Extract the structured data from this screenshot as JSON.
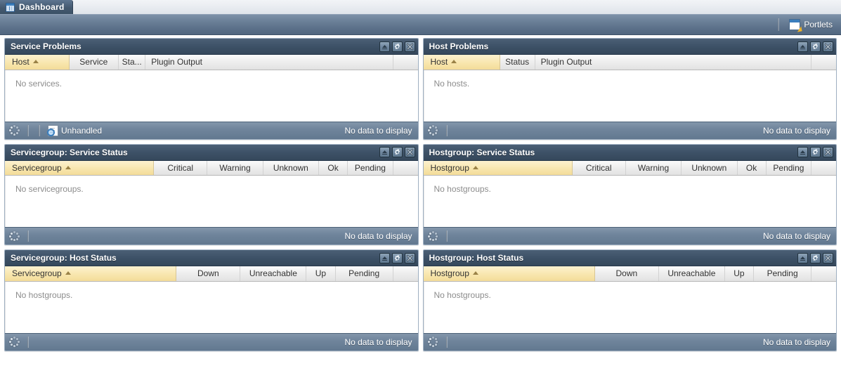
{
  "tabbar": {
    "tabs": [
      {
        "label": "Dashboard",
        "icon": "dashboard-icon",
        "active": true
      }
    ]
  },
  "toolbar": {
    "portlets_label": "Portlets",
    "portlets_icon": "portlets-icon"
  },
  "panel_tools": {
    "collapse_title": "Collapse",
    "settings_title": "Settings",
    "close_title": "Close"
  },
  "footer_common": {
    "refresh_icon": "refresh-spinner-icon",
    "no_data": "No data to display"
  },
  "colors": {
    "header_dark": "#3d5167",
    "toolbar_blue": "#62788f",
    "sort_highlight": "#f8e6ae",
    "tab_active": "#44596f",
    "empty_text": "#8c8c8c"
  },
  "panels": [
    {
      "id": "service-problems",
      "title": "Service Problems",
      "columns": [
        {
          "label": "Host",
          "sorted": true,
          "sort_dir": "asc",
          "width": "15.5%"
        },
        {
          "label": "Service",
          "sorted": false,
          "width": "12%"
        },
        {
          "label": "Sta...",
          "sorted": false,
          "width": "6.5%"
        },
        {
          "label": "Plugin Output",
          "sorted": false,
          "width": "60%",
          "align": "left"
        },
        {
          "label": "",
          "sorted": false,
          "width": "6%",
          "pad": true
        }
      ],
      "empty_message": "No services.",
      "footer": {
        "filter_label": "Unhandled",
        "filter_icon": "filter-page-icon",
        "status": "No data to display",
        "has_filter": true
      }
    },
    {
      "id": "host-problems",
      "title": "Host Problems",
      "columns": [
        {
          "label": "Host",
          "sorted": true,
          "sort_dir": "asc",
          "width": "18.5%"
        },
        {
          "label": "Status",
          "sorted": false,
          "width": "8.5%"
        },
        {
          "label": "Plugin Output",
          "sorted": false,
          "width": "67%",
          "align": "left"
        },
        {
          "label": "",
          "sorted": false,
          "width": "6%",
          "pad": true
        }
      ],
      "empty_message": "No hosts.",
      "footer": {
        "filter_label": "",
        "status": "No data to display",
        "has_filter": false
      }
    },
    {
      "id": "servicegroup-service-status",
      "title": "Servicegroup: Service Status",
      "columns": [
        {
          "label": "Servicegroup",
          "sorted": true,
          "sort_dir": "asc",
          "width": "36%"
        },
        {
          "label": "Critical",
          "sorted": false,
          "width": "13%"
        },
        {
          "label": "Warning",
          "sorted": false,
          "width": "13.5%"
        },
        {
          "label": "Unknown",
          "sorted": false,
          "width": "13.5%"
        },
        {
          "label": "Ok",
          "sorted": false,
          "width": "7%"
        },
        {
          "label": "Pending",
          "sorted": false,
          "width": "11%"
        },
        {
          "label": "",
          "sorted": false,
          "width": "6%",
          "pad": true
        }
      ],
      "empty_message": "No servicegroups.",
      "footer": {
        "filter_label": "",
        "status": "No data to display",
        "has_filter": false
      }
    },
    {
      "id": "hostgroup-service-status",
      "title": "Hostgroup: Service Status",
      "columns": [
        {
          "label": "Hostgroup",
          "sorted": true,
          "sort_dir": "asc",
          "width": "36%"
        },
        {
          "label": "Critical",
          "sorted": false,
          "width": "13%"
        },
        {
          "label": "Warning",
          "sorted": false,
          "width": "13.5%"
        },
        {
          "label": "Unknown",
          "sorted": false,
          "width": "13.5%"
        },
        {
          "label": "Ok",
          "sorted": false,
          "width": "7%"
        },
        {
          "label": "Pending",
          "sorted": false,
          "width": "11%"
        },
        {
          "label": "",
          "sorted": false,
          "width": "6%",
          "pad": true
        }
      ],
      "empty_message": "No hostgroups.",
      "footer": {
        "filter_label": "",
        "status": "No data to display",
        "has_filter": false
      }
    },
    {
      "id": "servicegroup-host-status",
      "title": "Servicegroup: Host Status",
      "columns": [
        {
          "label": "Servicegroup",
          "sorted": true,
          "sort_dir": "asc",
          "width": "41.5%"
        },
        {
          "label": "Down",
          "sorted": false,
          "width": "15.5%"
        },
        {
          "label": "Unreachable",
          "sorted": false,
          "width": "16%"
        },
        {
          "label": "Up",
          "sorted": false,
          "width": "7%"
        },
        {
          "label": "Pending",
          "sorted": false,
          "width": "14%"
        },
        {
          "label": "",
          "sorted": false,
          "width": "6%",
          "pad": true
        }
      ],
      "empty_message": "No hostgroups.",
      "footer": {
        "filter_label": "",
        "status": "No data to display",
        "has_filter": false
      }
    },
    {
      "id": "hostgroup-host-status",
      "title": "Hostgroup: Host Status",
      "columns": [
        {
          "label": "Hostgroup",
          "sorted": true,
          "sort_dir": "asc",
          "width": "41.5%"
        },
        {
          "label": "Down",
          "sorted": false,
          "width": "15.5%"
        },
        {
          "label": "Unreachable",
          "sorted": false,
          "width": "16%"
        },
        {
          "label": "Up",
          "sorted": false,
          "width": "7%"
        },
        {
          "label": "Pending",
          "sorted": false,
          "width": "14%"
        },
        {
          "label": "",
          "sorted": false,
          "width": "6%",
          "pad": true
        }
      ],
      "empty_message": "No hostgroups.",
      "footer": {
        "filter_label": "",
        "status": "No data to display",
        "has_filter": false
      }
    }
  ]
}
